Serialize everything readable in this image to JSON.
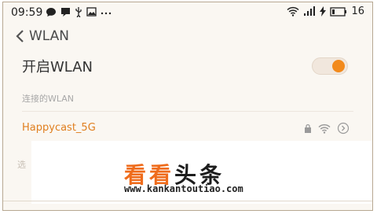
{
  "status_bar": {
    "time": "09:59",
    "battery_level": "16",
    "icons_left": [
      "chat-bubble-icon",
      "message-icon",
      "usb-icon",
      "image-icon",
      "more-icon"
    ],
    "icons_right": [
      "wifi-icon",
      "signal-icon",
      "charging-icon",
      "battery-icon"
    ]
  },
  "nav": {
    "title": "WLAN"
  },
  "wlan_toggle": {
    "label": "开启WLAN",
    "on": true,
    "accent": "#f28a1c"
  },
  "section": {
    "label": "连接的WLAN"
  },
  "network": {
    "ssid": "Happycast_5G",
    "accent": "#e07f1f"
  },
  "partial_text": "选",
  "watermark": {
    "logo_part1": "看看",
    "logo_part2": "头条",
    "url": "www.kankantoutiao.com",
    "logo_color": "#ef6c1c"
  }
}
